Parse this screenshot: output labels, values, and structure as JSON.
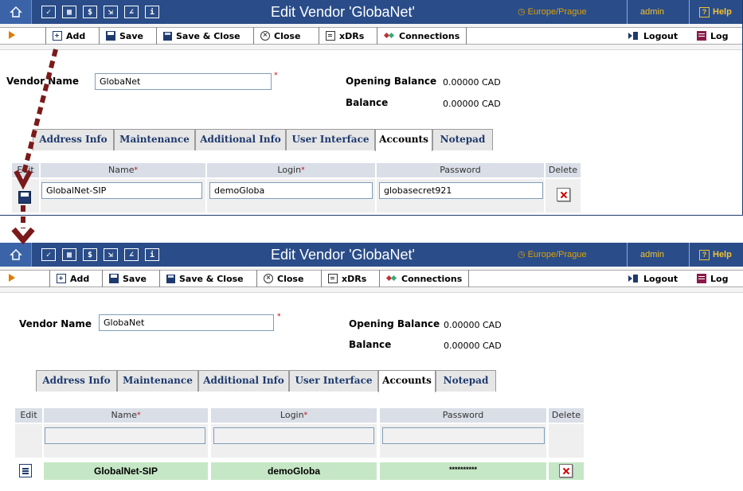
{
  "header": {
    "title": "Edit Vendor 'GlobaNet'",
    "timezone": "Europe/Prague",
    "user": "admin",
    "help": "Help"
  },
  "toolbar": {
    "add": "Add",
    "save": "Save",
    "save_close": "Save & Close",
    "close": "Close",
    "xdrs": "xDRs",
    "connections": "Connections",
    "logout": "Logout",
    "log": "Log"
  },
  "form": {
    "vendor_name_label": "Vendor Name",
    "vendor_name_value": "GlobaNet",
    "opening_balance_label": "Opening Balance",
    "opening_balance_value": "0.00000 CAD",
    "balance_label": "Balance",
    "balance_value": "0.00000 CAD"
  },
  "tabs": [
    "Address Info",
    "Maintenance",
    "Additional Info",
    "User Interface",
    "Accounts",
    "Notepad"
  ],
  "active_tab": "Accounts",
  "accounts_table": {
    "columns": {
      "edit": "Edit",
      "name": "Name",
      "login": "Login",
      "password": "Password",
      "delete": "Delete"
    }
  },
  "editing_row": {
    "name": "GlobalNet-SIP",
    "login": "demoGloba",
    "password": "globasecret921"
  },
  "saved_row": {
    "name": "GlobalNet-SIP",
    "login": "demoGloba",
    "password": "**********"
  },
  "colors": {
    "header_bg": "#2a4d89",
    "timezone": "#e0a000",
    "link_yellow": "#f2c230",
    "saved_row_bg": "#c6e7c6",
    "arrow": "#7a1a1a"
  }
}
